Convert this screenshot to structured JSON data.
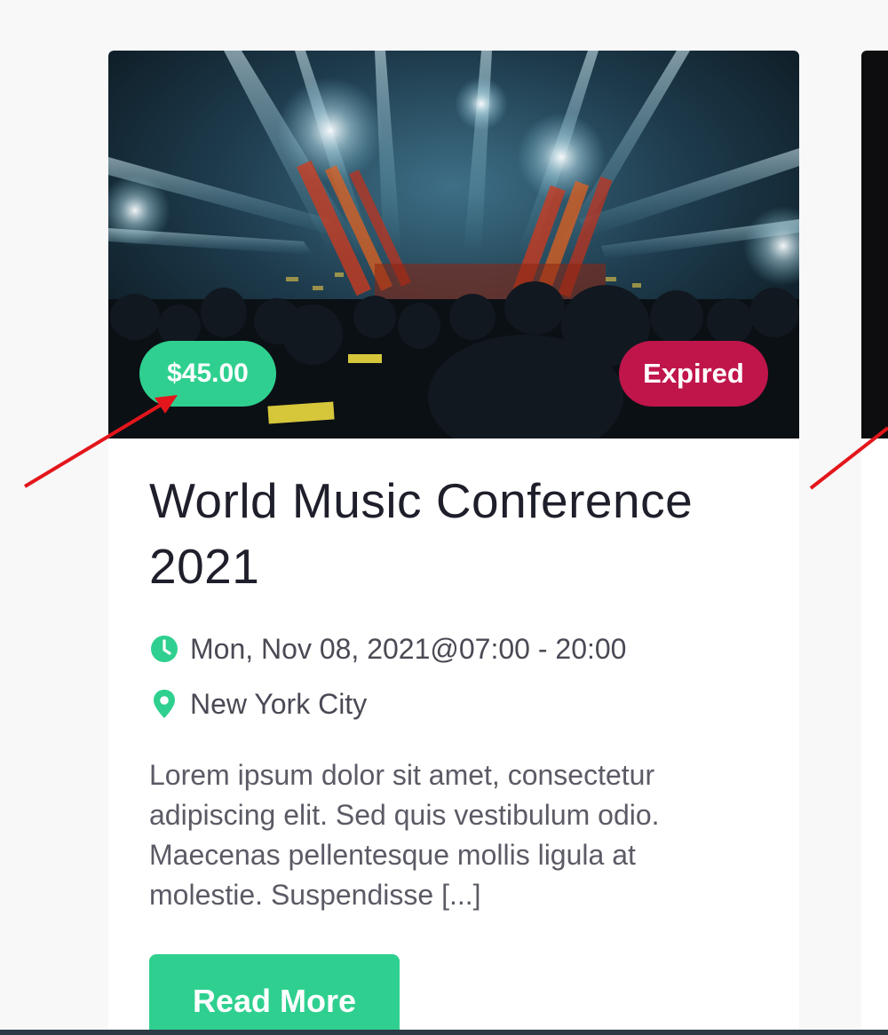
{
  "event": {
    "price": "$45.00",
    "status": "Expired",
    "title": "World Music Conference 2021",
    "datetime": "Mon, Nov 08, 2021@07:00 - 20:00",
    "location": "New York City",
    "excerpt": "Lorem ipsum dolor sit amet, consectetur adipiscing elit. Sed quis vestibulum odio. Maecenas pellentesque mollis ligula at molestie. Suspendisse [...]",
    "read_more_label": "Read More",
    "icons": {
      "datetime": "clock-icon",
      "location": "map-pin-icon"
    }
  },
  "colors": {
    "accent": "#2fd08f",
    "expired": "#c0154b",
    "title_text": "#1e1f2b",
    "body_text": "#5b5b66",
    "annotation_arrow": "#e3161b"
  }
}
